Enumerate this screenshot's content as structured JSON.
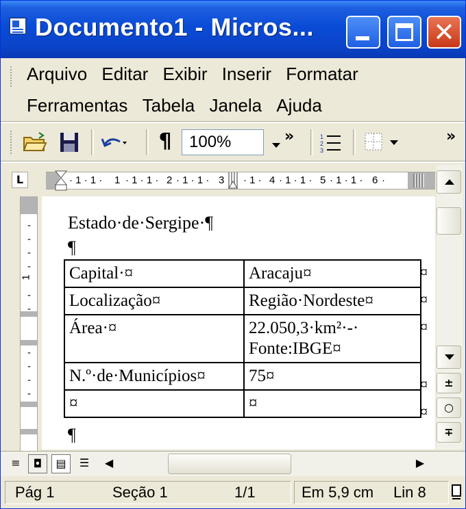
{
  "window": {
    "title": "Documento1 - Micros...",
    "buttons": {
      "minimize": "_",
      "maximize": "□",
      "close": "X"
    }
  },
  "menu": {
    "row1": [
      "Arquivo",
      "Editar",
      "Exibir",
      "Inserir",
      "Formatar"
    ],
    "row2": [
      "Ferramentas",
      "Tabela",
      "Janela",
      "Ajuda"
    ]
  },
  "toolbar": {
    "zoom": "100%",
    "pilcrow": "¶",
    "more": "»"
  },
  "ruler": {
    "corner": "L",
    "numbers": [
      "1",
      "2",
      "3",
      "4",
      "5",
      "6"
    ],
    "vertical_number": "1"
  },
  "document": {
    "heading": "Estado·de·Sergipe·¶",
    "empty_para": "¶",
    "last_para": "¶",
    "table": [
      [
        "Capital·¤",
        "Aracaju¤"
      ],
      [
        "Localização¤",
        "Região·Nordeste¤"
      ],
      [
        "Área·¤",
        "22.050,3·km²·-· Fonte:IBGE¤"
      ],
      [
        "N.º·de·Municípios¤",
        "75¤"
      ],
      [
        "¤",
        "¤"
      ]
    ],
    "row_end_mark": "¤"
  },
  "status": {
    "page": "Pág 1",
    "section": "Seção 1",
    "pages": "1/1",
    "position": "Em 5,9 cm",
    "line": "Lin 8"
  }
}
